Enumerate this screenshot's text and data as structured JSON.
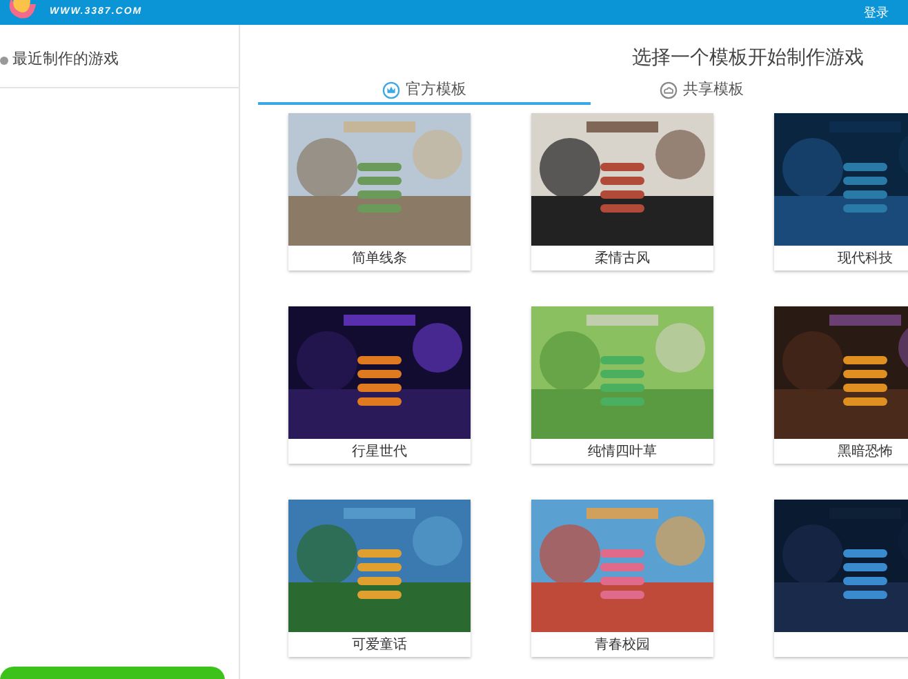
{
  "header": {
    "site_url": "WWW.3387.COM",
    "login": "登录"
  },
  "sidebar": {
    "items": [
      {
        "label": "最近制作的游戏"
      }
    ]
  },
  "main": {
    "title": "选择一个模板开始制作游戏",
    "tabs": [
      {
        "label": "官方模板",
        "selected": true
      },
      {
        "label": "共享模板",
        "selected": false
      }
    ],
    "templates": [
      {
        "name": "简单线条",
        "kind": "picture"
      },
      {
        "name": "柔情古风",
        "kind": "picture"
      },
      {
        "name": "现代科技",
        "kind": "picture"
      },
      {
        "name": "行星世代",
        "kind": "picture"
      },
      {
        "name": "纯情四叶草",
        "kind": "picture"
      },
      {
        "name": "黑暗恐怖",
        "kind": "picture"
      },
      {
        "name": "可爱童话",
        "kind": "picture"
      },
      {
        "name": "青春校园",
        "kind": "picture"
      },
      {
        "kind": "picture"
      }
    ]
  }
}
